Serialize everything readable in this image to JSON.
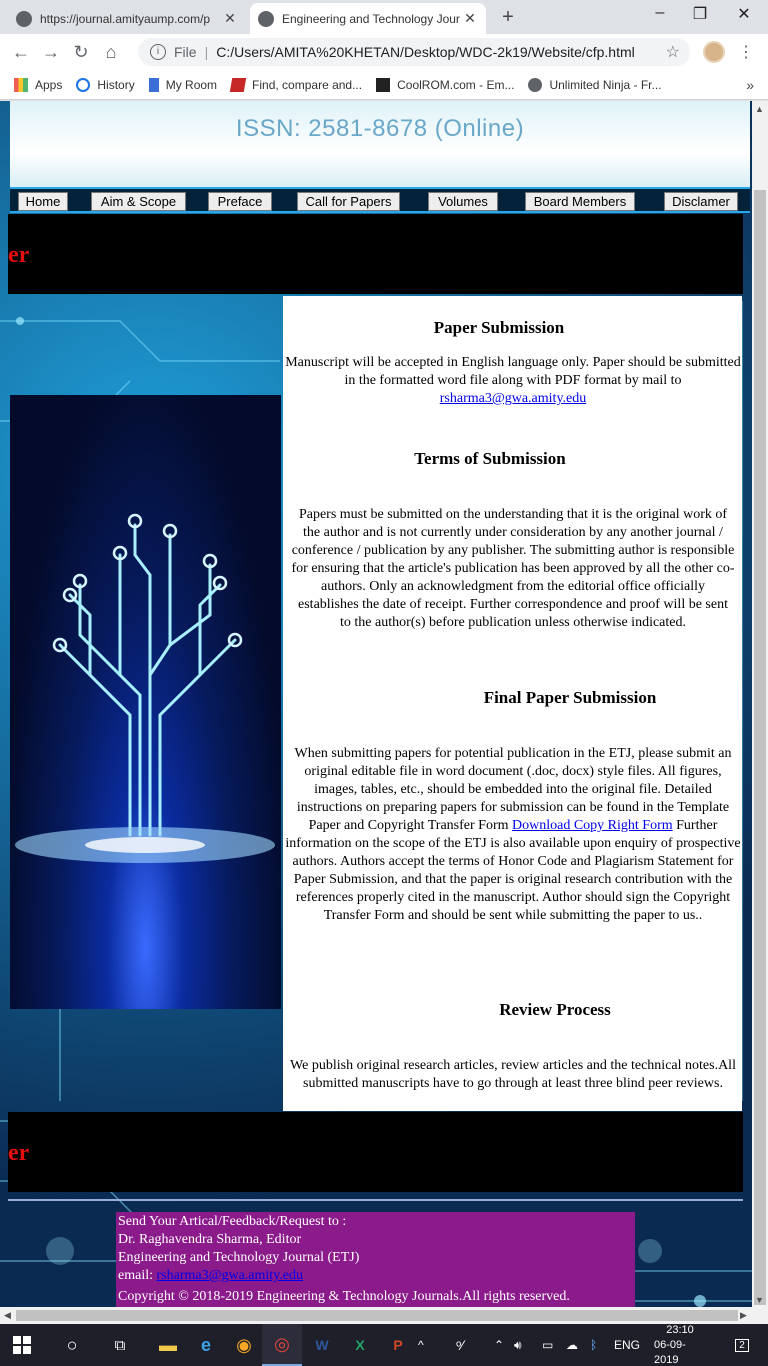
{
  "browser": {
    "tabs": [
      {
        "title": "https://journal.amityaump.com/p"
      },
      {
        "title": "Engineering and Technology Jour"
      }
    ],
    "address": {
      "scheme": "File",
      "url": "C:/Users/AMITA%20KHETAN/Desktop/WDC-2k19/Website/cfp.html"
    },
    "bookmarks": [
      "Apps",
      "History",
      "My Room",
      "Find, compare and...",
      "CoolROM.com - Em...",
      "Unlimited Ninja - Fr..."
    ]
  },
  "site": {
    "issn": "ISSN: 2581-8678 (Online)",
    "nav": [
      "Home",
      "Aim & Scope",
      "Preface",
      "Call for Papers",
      "Volumes",
      "Board Members",
      "Disclamer"
    ],
    "marquee_top": "er",
    "marquee_bottom": "er"
  },
  "content": {
    "s1_title": "Paper Submission",
    "s1_text": "Manuscript will be accepted in English language only. Paper should be submitted in the formatted word file along with PDF format by mail to",
    "s1_email": "rsharma3@gwa.amity.edu",
    "s2_title": "Terms of Submission",
    "s2_text": "Papers must be submitted on the understanding that it is the original work of the author and is not currently under consideration by any another journal / conference / publication by any publisher. The submitting author is responsible for ensuring that the article's publication has been approved by all the other co-authors. Only an acknowledgment from the editorial office officially establishes the date of receipt. Further correspondence and proof will be sent to the author(s) before publication unless otherwise indicated.",
    "s3_title": "Final Paper Submission",
    "s3_text_a": "When submitting papers for potential publication in the ETJ, please submit an original editable file in word document (.doc, docx) style files. All figures, images, tables, etc., should be embedded into the original file. Detailed instructions on preparing papers for submission can be found in the Template Paper and Copyright Transfer Form",
    "s3_link": "Download Copy Right Form",
    "s3_text_b": "Further information on the scope of the ETJ is also available upon enquiry of prospective authors. Authors accept the terms of Honor Code and Plagiarism Statement for Paper Submission, and that the paper is original research contribution with the references properly cited in the manuscript. Author should sign the Copyright Transfer Form and should be sent while submitting the paper to us..",
    "s4_title": "Review Process",
    "s4_text": "We publish original research articles, review articles and the technical notes.All submitted manuscripts have to go through at least three blind peer reviews."
  },
  "footer": {
    "line1": "Send Your Artical/Feedback/Request to :",
    "line2": "Dr. Raghavendra Sharma, Editor",
    "line3": "Engineering and Technology Journal (ETJ)",
    "email_label": "email:",
    "email": "rsharma3@gwa.amity.edu",
    "copyright": "Copyright © 2018-2019 Engineering & Technology Journals.All rights reserved."
  },
  "taskbar": {
    "lang": "ENG",
    "time": "23:10",
    "date": "06-09-2019",
    "notifications": "2"
  },
  "colors": {
    "accent": "#2aa7e8",
    "marquee": "#e41010",
    "footer_bg": "#8b1a8b"
  }
}
